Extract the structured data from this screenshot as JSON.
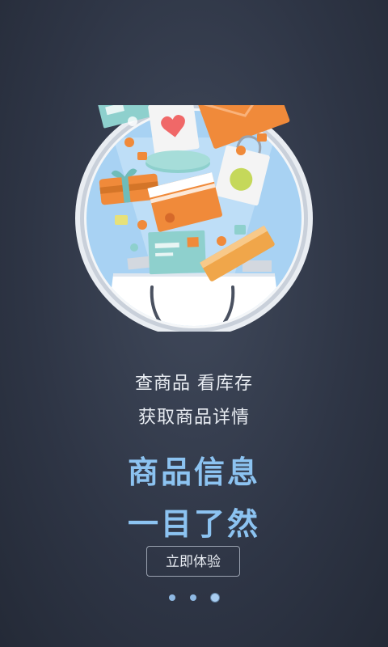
{
  "intro": {
    "line1": "查商品  看库存",
    "line2": "获取商品详情",
    "headline1": "商品信息",
    "headline2": "一目了然",
    "cta_label": "立即体验"
  },
  "pager": {
    "total_pages": 3,
    "current_page": 3
  },
  "colors": {
    "background": "#2e3545",
    "headline": "#8cc3f1",
    "circle_bg": "#a8d2f3",
    "orange": "#f08a3a"
  }
}
